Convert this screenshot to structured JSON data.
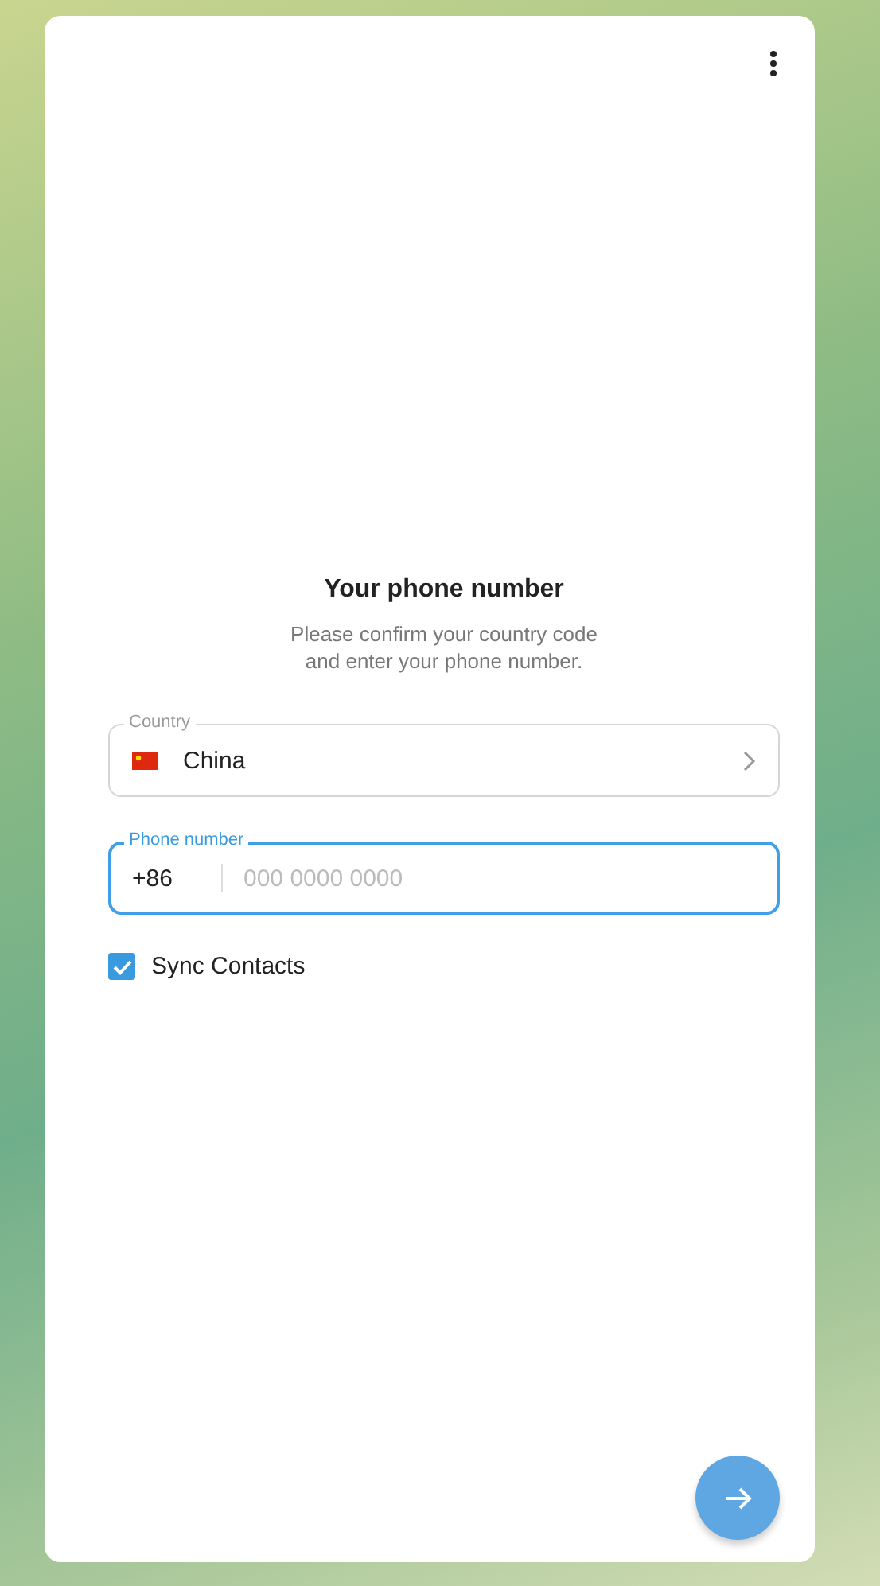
{
  "title": "Your phone number",
  "subtitle": [
    "Please confirm your country code",
    "and enter your phone number."
  ],
  "country": {
    "label": "Country",
    "value": "China"
  },
  "phone": {
    "label": "Phone number",
    "code": "+86",
    "placeholder": "000 0000 0000",
    "focused": true
  },
  "sync_contacts": {
    "label": "Sync Contacts",
    "checked": true
  }
}
